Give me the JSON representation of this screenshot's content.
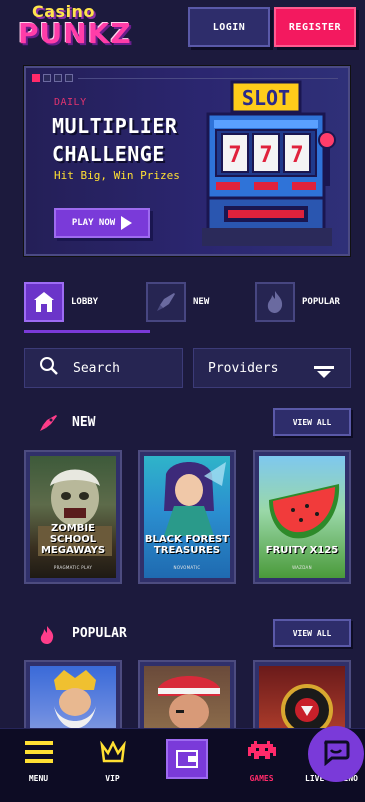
{
  "header": {
    "logo_top": "Casino",
    "logo_bottom": "PUNKZ",
    "login_label": "LOGIN",
    "register_label": "REGISTER"
  },
  "banner": {
    "kicker": "DAILY",
    "title_line1": "MULTIPLIER",
    "title_line2": "CHALLENGE",
    "subtitle": "Hit Big, Win Prizes",
    "cta_label": "PLAY NOW",
    "slot_sign": "SLOT",
    "slot_digits": [
      "7",
      "7",
      "7"
    ],
    "slides_total": 4,
    "slide_active": 1
  },
  "tabs": [
    {
      "label": "LOBBY",
      "icon": "castle-icon",
      "active": true
    },
    {
      "label": "NEW",
      "icon": "rocket-icon",
      "active": false
    },
    {
      "label": "POPULAR",
      "icon": "fire-icon",
      "active": false
    }
  ],
  "filters": {
    "search_label": "Search",
    "providers_label": "Providers"
  },
  "sections": {
    "new": {
      "title": "NEW",
      "view_all": "VIEW ALL",
      "games": [
        {
          "title_line1": "ZOMBIE SCHOOL",
          "title_line2": "MEGAWAYS",
          "provider": "PRAGMATIC PLAY"
        },
        {
          "title_line1": "BLACK FOREST",
          "title_line2": "TREASURES",
          "provider": "NOVOMATIC"
        },
        {
          "title_line1": "FRUITY X125",
          "title_line2": "",
          "provider": "WAZDAN"
        }
      ]
    },
    "popular": {
      "title": "POPULAR",
      "view_all": "VIEW ALL"
    }
  },
  "bottom_nav": [
    {
      "label": "MENU",
      "icon": "hamburger-menu-icon",
      "active": false
    },
    {
      "label": "VIP",
      "icon": "crown-icon",
      "active": false
    },
    {
      "label": "",
      "icon": "wallet-icon",
      "active": false
    },
    {
      "label": "GAMES",
      "icon": "space-invader-icon",
      "active": true
    },
    {
      "label": "LIVE CASINO",
      "icon": "chip-icon",
      "active": false
    }
  ],
  "colors": {
    "background": "#1c1a3d",
    "accent_pink": "#f3195f",
    "accent_purple": "#7a3ad9",
    "accent_yellow": "#ffe033"
  }
}
